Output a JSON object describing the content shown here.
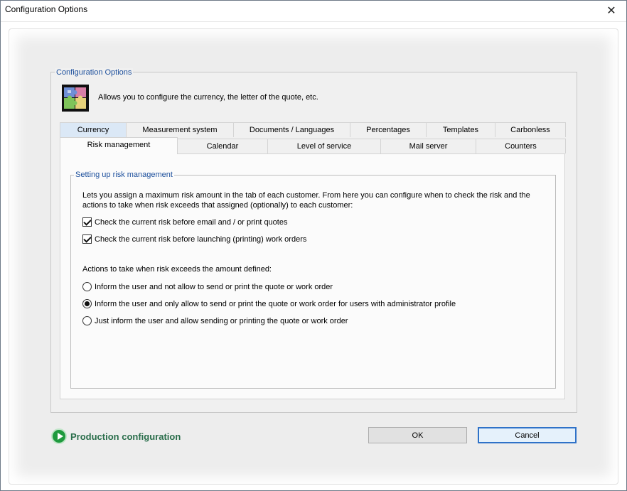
{
  "window": {
    "title": "Configuration Options",
    "close_glyph": "✕"
  },
  "group": {
    "legend": "Configuration Options",
    "description": "Allows you to configure the currency, the letter of the quote, etc.",
    "icon": "puzzle-icon"
  },
  "tabs": {
    "row_top": [
      "Currency",
      "Measurement system",
      "Documents / Languages",
      "Percentages",
      "Templates",
      "Carbonless"
    ],
    "row_bottom": [
      "Risk management",
      "Calendar",
      "Level of service",
      "Mail server",
      "Counters"
    ],
    "active": "Risk management"
  },
  "risk": {
    "legend": "Setting up risk management",
    "intro": "Lets you assign a maximum risk amount in the  tab of each customer. From here you can configure when to check the risk and the actions to take when risk exceeds that assigned (optionally) to each customer:",
    "checks": [
      {
        "label": "Check the current risk before email and / or print quotes",
        "checked": true
      },
      {
        "label": "Check the current risk before launching (printing) work orders",
        "checked": true
      }
    ],
    "actions_heading": "Actions to take when risk exceeds the amount defined:",
    "options": [
      {
        "label": "Inform the user and not allow to send or print the quote or work order",
        "selected": false
      },
      {
        "label": "Inform the user and only allow to send or print the quote or work order for users with administrator profile",
        "selected": true
      },
      {
        "label": "Just inform the user and allow sending or printing the quote or work order",
        "selected": false
      }
    ]
  },
  "footer": {
    "production_label": "Production configuration",
    "ok": "OK",
    "cancel": "Cancel"
  },
  "colors": {
    "accent": "#1c4f9c",
    "production": "#2a6e4b",
    "play": "#1f9a3e"
  }
}
